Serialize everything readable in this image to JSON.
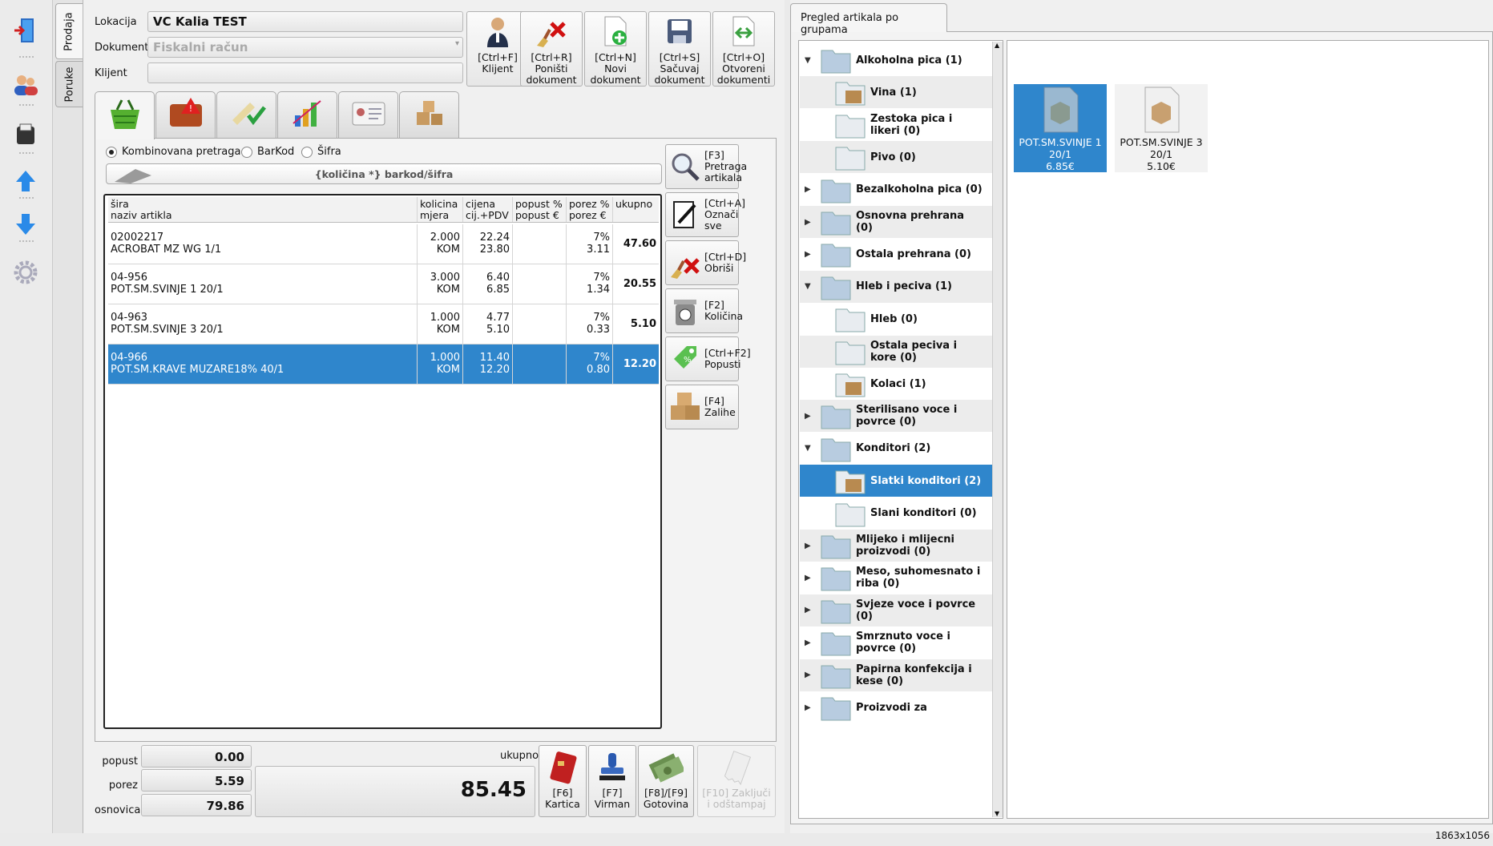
{
  "form": {
    "lokacija_label": "Lokacija",
    "lokacija_value": "VC Kalia TEST",
    "dokument_label": "Dokument",
    "dokument_value": "Fiskalni račun",
    "klijent_label": "Klijent",
    "klijent_value": ""
  },
  "vertical_tabs": [
    "Prodaja",
    "Poruke"
  ],
  "toolbar": [
    {
      "l1": "[Ctrl+F]",
      "l2": "Klijent",
      "l3": ""
    },
    {
      "l1": "[Ctrl+R]",
      "l2": "Poništi",
      "l3": "dokument"
    },
    {
      "l1": "[Ctrl+N]",
      "l2": "Novi",
      "l3": "dokument"
    },
    {
      "l1": "[Ctrl+S]",
      "l2": "Sačuvaj",
      "l3": "dokument"
    },
    {
      "l1": "[Ctrl+O]",
      "l2": "Otvoreni",
      "l3": "dokumenti"
    }
  ],
  "search": {
    "opt1": "Kombinovana pretraga",
    "opt2": "BarKod",
    "opt3": "Šifra",
    "placeholder": "{količina *} barkod/šifra"
  },
  "grid": {
    "headers": [
      {
        "a": "šira",
        "b": "naziv artikla"
      },
      {
        "a": "kolicina",
        "b": "mjera"
      },
      {
        "a": "cijena",
        "b": "cij.+PDV"
      },
      {
        "a": "popust %",
        "b": "popust €"
      },
      {
        "a": "porez %",
        "b": "porez €"
      },
      {
        "a": "ukupno",
        "b": ""
      }
    ],
    "rows": [
      {
        "code": "02002217",
        "name": "ACROBAT MZ WG 1/1",
        "qty": "2.000",
        "unit": "KOM",
        "price": "22.24",
        "price_vat": "23.80",
        "disc_pct": "",
        "disc_eur": "",
        "tax_pct": "7%",
        "tax_eur": "3.11",
        "total": "47.60"
      },
      {
        "code": "04-956",
        "name": "POT.SM.SVINJE 1 20/1",
        "qty": "3.000",
        "unit": "KOM",
        "price": "6.40",
        "price_vat": "6.85",
        "disc_pct": "",
        "disc_eur": "",
        "tax_pct": "7%",
        "tax_eur": "1.34",
        "total": "20.55"
      },
      {
        "code": "04-963",
        "name": "POT.SM.SVINJE 3 20/1",
        "qty": "1.000",
        "unit": "KOM",
        "price": "4.77",
        "price_vat": "5.10",
        "disc_pct": "",
        "disc_eur": "",
        "tax_pct": "7%",
        "tax_eur": "0.33",
        "total": "5.10"
      },
      {
        "code": "04-966",
        "name": "POT.SM.KRAVE MUZARE18% 40/1",
        "qty": "1.000",
        "unit": "KOM",
        "price": "11.40",
        "price_vat": "12.20",
        "disc_pct": "",
        "disc_eur": "",
        "tax_pct": "7%",
        "tax_eur": "0.80",
        "total": "12.20"
      }
    ]
  },
  "side_buttons": [
    {
      "l1": "[F3]",
      "l2": "Pretraga",
      "l3": "artikala"
    },
    {
      "l1": "[Ctrl+A]",
      "l2": "Označi sve",
      "l3": ""
    },
    {
      "l1": "[Ctrl+D]",
      "l2": "Obriši",
      "l3": ""
    },
    {
      "l1": "[F2]",
      "l2": "Količina",
      "l3": ""
    },
    {
      "l1": "[Ctrl+F2]",
      "l2": "Popusti",
      "l3": ""
    },
    {
      "l1": "[F4]",
      "l2": "Zalihe",
      "l3": ""
    }
  ],
  "totals": {
    "popust_label": "popust",
    "popust": "0.00",
    "porez_label": "porez",
    "porez": "5.59",
    "osnovica_label": "osnovica",
    "osnovica": "79.86",
    "ukupno_label": "ukupno",
    "ukupno": "85.45"
  },
  "pay_buttons": [
    {
      "l1": "[F6]",
      "l2": "Kartica"
    },
    {
      "l1": "[F7]",
      "l2": "Virman"
    },
    {
      "l1": "[F8]/[F9]",
      "l2": "Gotovina"
    },
    {
      "l1": "[F10] Zaključi",
      "l2": "i odštampaj"
    }
  ],
  "right_panel": {
    "tab_label": "Pregled artikala po grupama",
    "tree": [
      {
        "l1": "Alkoholna pica (1)",
        "l2": ""
      },
      {
        "l1": "Vina (1)",
        "l2": ""
      },
      {
        "l1": "Zestoka pica i",
        "l2": "likeri (0)"
      },
      {
        "l1": "Pivo (0)",
        "l2": ""
      },
      {
        "l1": "Bezalkoholna pica (0)",
        "l2": ""
      },
      {
        "l1": "Osnovna prehrana",
        "l2": "(0)"
      },
      {
        "l1": "Ostala prehrana (0)",
        "l2": ""
      },
      {
        "l1": "Hleb i peciva (1)",
        "l2": ""
      },
      {
        "l1": "Hleb (0)",
        "l2": ""
      },
      {
        "l1": "Ostala peciva i",
        "l2": "kore (0)"
      },
      {
        "l1": "Kolaci (1)",
        "l2": ""
      },
      {
        "l1": "Sterilisano voce i",
        "l2": "povrce (0)"
      },
      {
        "l1": "Konditori (2)",
        "l2": ""
      },
      {
        "l1": "Slatki konditori (2)",
        "l2": ""
      },
      {
        "l1": "Slani konditori (0)",
        "l2": ""
      },
      {
        "l1": "Mlijeko i mlijecni",
        "l2": "proizvodi (0)"
      },
      {
        "l1": "Meso, suhomesnato i",
        "l2": "riba (0)"
      },
      {
        "l1": "Svjeze voce i povrce",
        "l2": "(0)"
      },
      {
        "l1": "Smrznuto voce i",
        "l2": "povrce (0)"
      },
      {
        "l1": "Papirna konfekcija i",
        "l2": "kese (0)"
      },
      {
        "l1": "Proizvodi za",
        "l2": ""
      }
    ],
    "articles": [
      {
        "l1": "POT.SM.SVINJE 1",
        "l2": "20/1",
        "price": "6.85€"
      },
      {
        "l1": "POT.SM.SVINJE 3",
        "l2": "20/1",
        "price": "5.10€"
      }
    ]
  },
  "status": {
    "dims": "1863x1056"
  },
  "colors": {
    "selection": "#2f86cc"
  }
}
